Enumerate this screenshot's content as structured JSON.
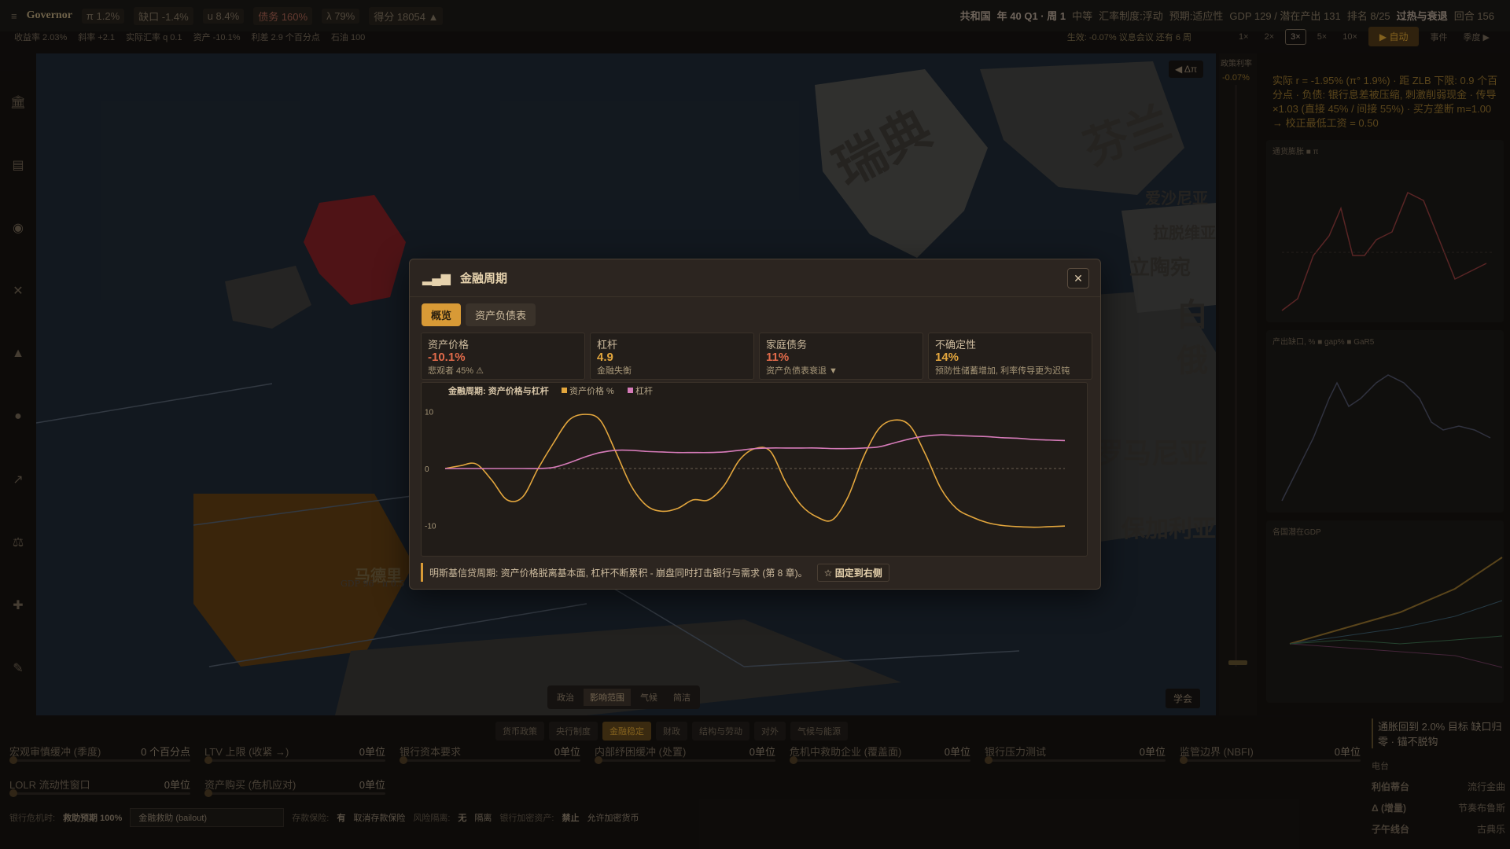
{
  "topbar": {
    "logo": "Governor",
    "chips": [
      "π 1.2%",
      "缺口 -1.4%",
      "u 8.4%",
      "债务 160%",
      "λ 79%",
      "得分 18054 ▲"
    ],
    "right": [
      "共和国",
      "年 40 Q1 · 周 1",
      "中等",
      "汇率制度:浮动",
      "预期:适应性",
      "GDP 129 / 潜在产出 131",
      "排名 8/25",
      "过热与衰退",
      "回合 156"
    ]
  },
  "subbar": {
    "items": [
      "收益率 2.03%",
      "斜率 +2.1",
      "实际汇率 q 0.1",
      "资产 -10.1%",
      "利差 2.9 个百分点",
      "石油 100"
    ],
    "status": "生效: -0.07% 议息会议 还有 6 周"
  },
  "speed": {
    "options": [
      "1×",
      "2×",
      "3×",
      "5×",
      "10×"
    ],
    "selected": "3×",
    "auto": "▶ 自动",
    "events": "事件",
    "quarter": "季度 ▶"
  },
  "sidebar": {
    "icons": [
      "bank-icon",
      "ledger-icon",
      "coins-icon",
      "tools-icon",
      "chart-icon",
      "globe-icon",
      "cycle-icon",
      "balance-icon",
      "gear-icon",
      "edit-icon"
    ]
  },
  "map": {
    "labels": [
      "瑞典",
      "芬兰",
      "爱沙尼亚",
      "拉脱维亚",
      "立陶宛",
      "白俄",
      "罗马尼亚",
      "保加利亚",
      "马德里",
      "GDP 96 · π 0.5"
    ],
    "modes": [
      "政治",
      "影响范围",
      "气候",
      "简洁"
    ],
    "mode_selected": "影响范围",
    "dpi_btn": "◀ Δπ",
    "learn_btn": "学会"
  },
  "policy_rate": {
    "label": "政策利率",
    "value": "-0.07%"
  },
  "right_panel": {
    "text": "实际 r = -1.95% (π° 1.9%) · 距 ZLB 下限: 0.9 个百分点 · 负债: 银行息差被压缩, 刺激削弱现金 · 传导 ×1.03 (直接 45% / 间接 55%) · 买方垄断 m=1.00 → 校正最低工资 = 0.50",
    "mini1": "通货膨胀 ■ π",
    "mini2": "产出缺口, % ■ gap% ■ GaR5",
    "mini3": "各国潜在GDP"
  },
  "modal": {
    "title": "金融周期",
    "tabs": [
      "概览",
      "资产负债表"
    ],
    "tab_selected": "概览",
    "cards": [
      {
        "label": "资产价格",
        "value": "-10.1%",
        "sub": "悲观者 45% ⚠",
        "color": "#e06a4a"
      },
      {
        "label": "杠杆",
        "value": "4.9",
        "sub": "金融失衡",
        "color": "#e3a63d"
      },
      {
        "label": "家庭债务",
        "value": "11%",
        "sub": "资产负债表衰退 ▼",
        "color": "#e06a4a"
      },
      {
        "label": "不确定性",
        "value": "14%",
        "sub": "预防性储蓄增加, 利率传导更为迟钝",
        "color": "#e3a63d"
      }
    ],
    "footnote": "明斯基信贷周期: 资产价格脱离基本面, 杠杆不断累积 - 崩盘同时打击银行与需求 (第 8 章)。",
    "pin": "☆ 固定到右侧"
  },
  "chart_data": {
    "type": "line",
    "title": "金融周期: 资产价格与杠杆",
    "ylim": [
      -12,
      12
    ],
    "yticks": [
      10,
      0,
      -10
    ],
    "x": [
      0,
      1,
      2,
      3,
      4,
      5,
      6,
      7,
      8,
      9,
      10,
      11,
      12,
      13,
      14,
      15,
      16,
      17,
      18,
      19,
      20,
      21,
      22,
      23,
      24,
      25,
      26,
      27,
      28,
      29,
      30,
      31,
      32,
      33,
      34,
      35,
      36,
      37,
      38,
      39,
      40
    ],
    "series": [
      {
        "name": "资产价格 %",
        "color": "#e3a63d",
        "values": [
          0,
          0.5,
          0.8,
          -2,
          -5.5,
          -5,
          0,
          4.5,
          8.5,
          9.5,
          8.5,
          3,
          -3,
          -6.5,
          -7.5,
          -7,
          -5.5,
          -5.5,
          -3,
          1.5,
          3.5,
          3,
          -2.5,
          -6.5,
          -8.5,
          -9,
          -5,
          2,
          7,
          8.5,
          7.5,
          2.5,
          -3.5,
          -7,
          -8.5,
          -9.5,
          -10,
          -10.2,
          -10.3,
          -10.2,
          -10.1
        ]
      },
      {
        "name": "杠杆",
        "color": "#d67bb9",
        "values": [
          0,
          0,
          0,
          0,
          0,
          0,
          0,
          0.2,
          1,
          2,
          2.8,
          3.2,
          3.2,
          3,
          2.9,
          2.8,
          2.8,
          2.8,
          2.9,
          3.2,
          3.5,
          3.6,
          3.6,
          3.6,
          3.6,
          3.5,
          3.5,
          3.6,
          3.8,
          4.5,
          5.2,
          5.7,
          5.9,
          5.8,
          5.7,
          5.6,
          5.4,
          5.3,
          5.1,
          5,
          4.9
        ]
      }
    ]
  },
  "bottom": {
    "tabs": [
      "货币政策",
      "央行制度",
      "金融稳定",
      "财政",
      "结构与劳动",
      "对外",
      "气候与能源"
    ],
    "tab_selected": "金融稳定",
    "sliders": [
      {
        "label": "宏观审慎缓冲 (季度)",
        "value": "0 个百分点"
      },
      {
        "label": "LTV 上限 (收紧 →)",
        "value": "0单位"
      },
      {
        "label": "银行资本要求",
        "value": "0单位"
      },
      {
        "label": "内部纾困缓冲 (处置)",
        "value": "0单位"
      },
      {
        "label": "危机中救助企业 (覆盖面)",
        "value": "0单位"
      },
      {
        "label": "银行压力测试",
        "value": "0单位"
      },
      {
        "label": "监管边界 (NBFI)",
        "value": "0单位"
      },
      {
        "label": "LOLR 流动性窗口",
        "value": "0单位"
      },
      {
        "label": "资产购买 (危机应对)",
        "value": "0单位"
      }
    ],
    "row": {
      "crisis_label": "银行危机时:",
      "crisis_value": "救助预期 100%",
      "select": "金融救助 (bailout)",
      "deposit_label": "存款保险:",
      "deposit_value": "有",
      "deposit_btn": "取消存款保险",
      "ring_label": "风险隔离:",
      "ring_value": "无",
      "ring_btn": "隔离",
      "crypto_label": "银行加密资产:",
      "crypto_value": "禁止",
      "crypto_btn": "允许加密货币"
    },
    "right": {
      "alert": "通胀回到 2.0% 目标 缺口归零 · 锚不脱钩",
      "radio": "电台",
      "r1a": "利伯蒂台",
      "r1b": "流行金曲",
      "r2a": "Δ (增量)",
      "r2b": "节奏布鲁斯",
      "r3a": "子午线台",
      "r3b": "古典乐"
    }
  }
}
